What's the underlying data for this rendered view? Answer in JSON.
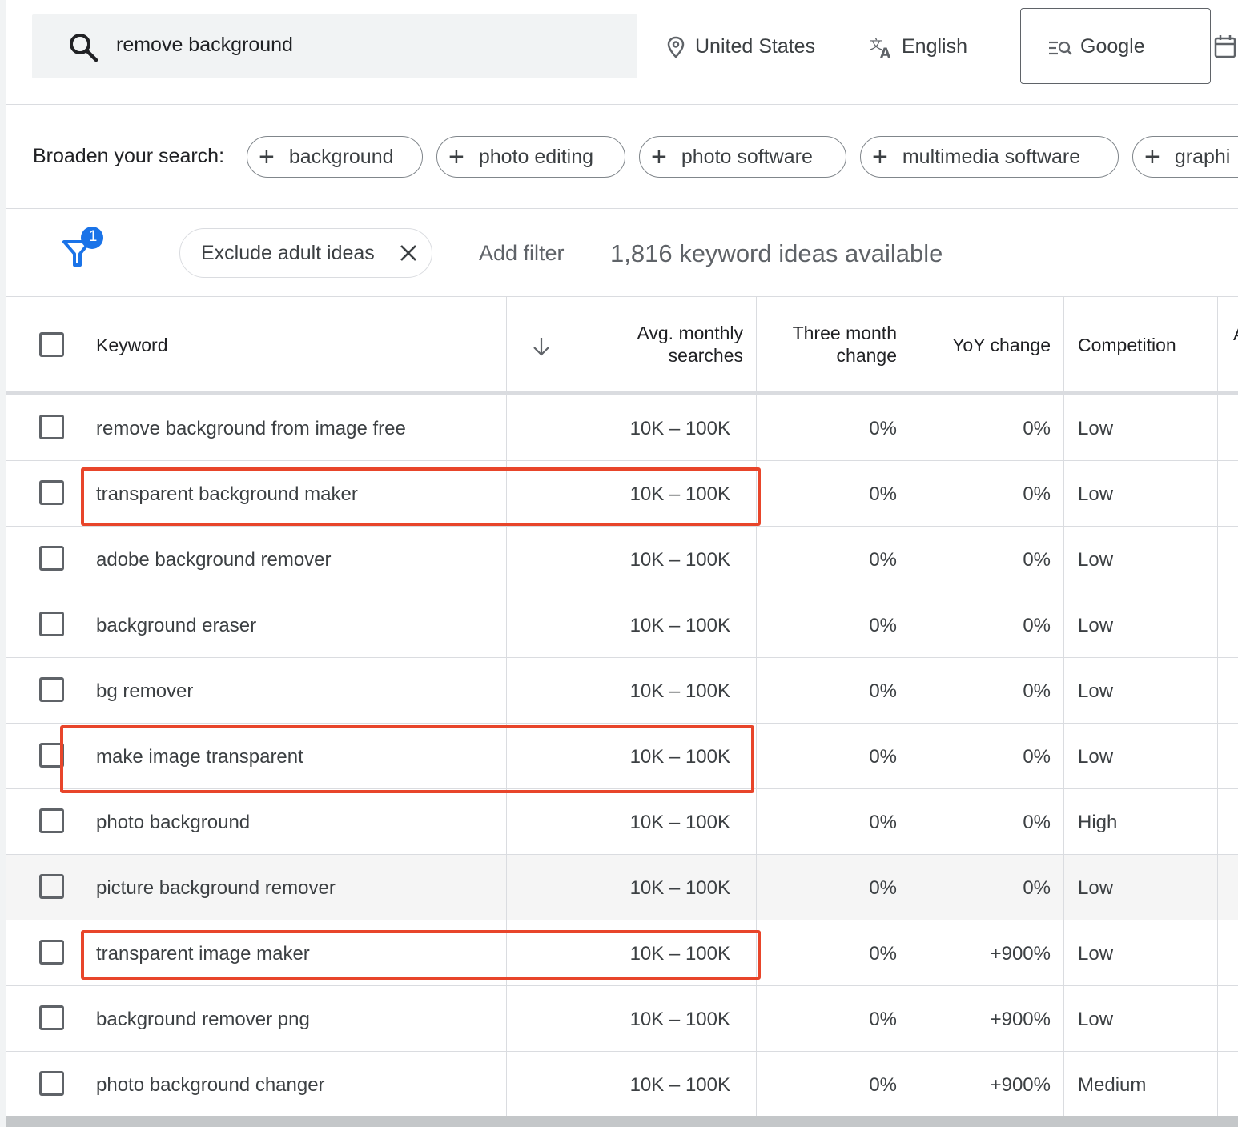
{
  "search": {
    "query": "remove background"
  },
  "location": {
    "label": "United States"
  },
  "language": {
    "label": "English"
  },
  "network": {
    "label": "Google"
  },
  "broaden": {
    "label": "Broaden your search:",
    "chips": [
      "background",
      "photo editing",
      "photo software",
      "multimedia software",
      "graphi"
    ]
  },
  "filters": {
    "active_count": "1",
    "exclude_chip": "Exclude adult ideas",
    "add_filter": "Add filter",
    "ideas_available": "1,816 keyword ideas available"
  },
  "table": {
    "headers": {
      "keyword": "Keyword",
      "avg_line1": "Avg. monthly",
      "avg_line2": "searches",
      "three_line1": "Three month",
      "three_line2": "change",
      "yoy": "YoY change",
      "competition": "Competition",
      "next": "A"
    },
    "rows": [
      {
        "keyword": "remove background from image free",
        "avg": "10K – 100K",
        "three": "0%",
        "yoy": "0%",
        "competition": "Low"
      },
      {
        "keyword": "transparent background maker",
        "avg": "10K – 100K",
        "three": "0%",
        "yoy": "0%",
        "competition": "Low"
      },
      {
        "keyword": "adobe background remover",
        "avg": "10K – 100K",
        "three": "0%",
        "yoy": "0%",
        "competition": "Low"
      },
      {
        "keyword": "background eraser",
        "avg": "10K – 100K",
        "three": "0%",
        "yoy": "0%",
        "competition": "Low"
      },
      {
        "keyword": "bg remover",
        "avg": "10K – 100K",
        "three": "0%",
        "yoy": "0%",
        "competition": "Low"
      },
      {
        "keyword": "make image transparent",
        "avg": "10K – 100K",
        "three": "0%",
        "yoy": "0%",
        "competition": "Low"
      },
      {
        "keyword": "photo background",
        "avg": "10K – 100K",
        "three": "0%",
        "yoy": "0%",
        "competition": "High"
      },
      {
        "keyword": "picture background remover",
        "avg": "10K – 100K",
        "three": "0%",
        "yoy": "0%",
        "competition": "Low"
      },
      {
        "keyword": "transparent image maker",
        "avg": "10K – 100K",
        "three": "0%",
        "yoy": "+900%",
        "competition": "Low"
      },
      {
        "keyword": "background remover png",
        "avg": "10K – 100K",
        "three": "0%",
        "yoy": "+900%",
        "competition": "Low"
      },
      {
        "keyword": "photo background changer",
        "avg": "10K – 100K",
        "three": "0%",
        "yoy": "+900%",
        "competition": "Medium"
      }
    ]
  },
  "colors": {
    "highlight": "#e8452a",
    "filter_accent": "#1a73e8",
    "hover_row": "#f5f5f5"
  }
}
